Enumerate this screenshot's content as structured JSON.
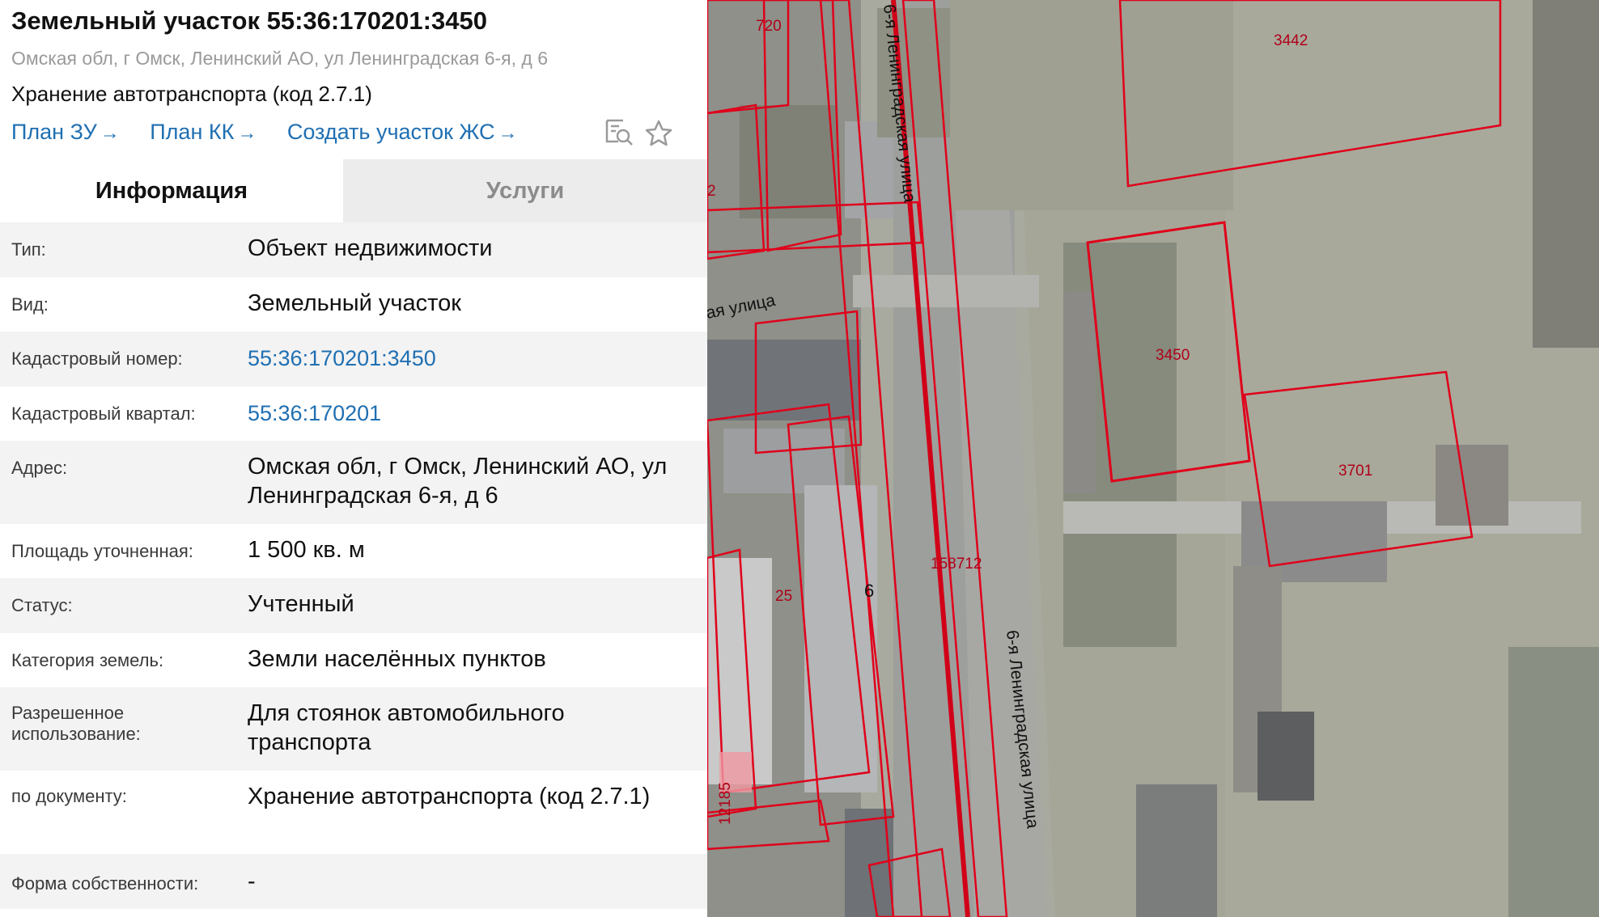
{
  "panel": {
    "title": "Земельный участок 55:36:170201:3450",
    "address": "Омская обл, г Омск, Ленинский АО, ул Ленинградская 6-я, д 6",
    "use": "Хранение автотранспорта (код 2.7.1)",
    "links": [
      {
        "label": "План ЗУ",
        "arrow": "→"
      },
      {
        "label": "План КК",
        "arrow": "→"
      },
      {
        "label": "Создать участок ЖС",
        "arrow": "→"
      }
    ],
    "tools": {
      "search_icon": "search-document-icon",
      "star_icon": "star-icon"
    }
  },
  "tabs": {
    "info": "Информация",
    "services": "Услуги"
  },
  "rows": [
    {
      "label": "Тип:",
      "value": "Объект недвижимости"
    },
    {
      "label": "Вид:",
      "value": "Земельный участок"
    },
    {
      "label": "Кадастровый номер:",
      "value": "55:36:170201:3450"
    },
    {
      "label": "Кадастровый квартал:",
      "value": "55:36:170201"
    },
    {
      "label": "Адрес:",
      "value": "Омская обл, г Омск, Ленинский АО, ул Ленинградская 6-я, д 6"
    },
    {
      "label": "Площадь уточненная:",
      "value": "1 500 кв. м"
    },
    {
      "label": "Статус:",
      "value": "Учтенный"
    },
    {
      "label": "Категория земель:",
      "value": "Земли населённых пунктов"
    },
    {
      "label": "Разрешенное использование:",
      "value": "Для стоянок автомобильного транспорта"
    },
    {
      "label": "по документу:",
      "value": "Хранение автотранспорта (код 2.7.1)"
    },
    {
      "label": "Форма собственности:",
      "value": "-"
    }
  ],
  "map": {
    "parcel_labels": [
      "720",
      "3442",
      "2",
      "3450",
      "3701",
      "158712",
      "25",
      "6",
      "12185"
    ],
    "street_labels": [
      "6-я Ленинградская улица",
      "6-я Ленинградская улица",
      "ая улица"
    ]
  },
  "colors": {
    "link": "#1f6fb2",
    "parcel_border": "#e0001b",
    "tab_inactive_bg": "#ececec"
  }
}
